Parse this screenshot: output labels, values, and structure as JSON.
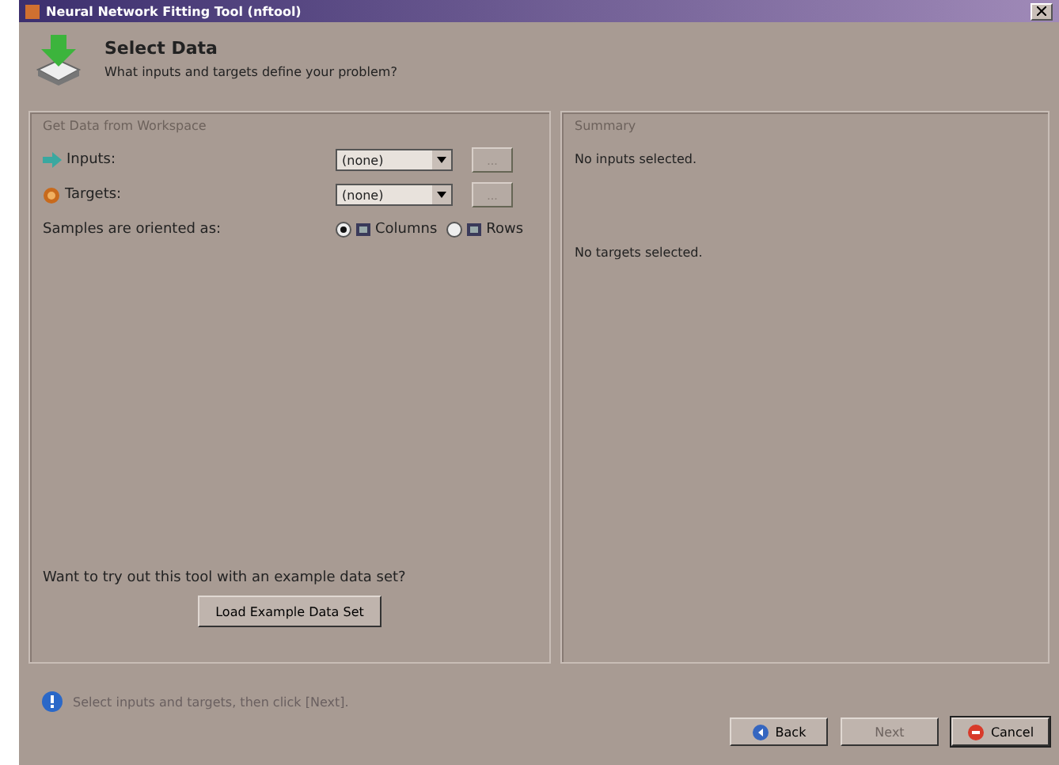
{
  "window": {
    "title": "Neural Network Fitting Tool (nftool)"
  },
  "header": {
    "title": "Select Data",
    "subtitle": "What inputs and targets define your problem?"
  },
  "workspace": {
    "title": "Get Data from Workspace",
    "rows": [
      {
        "kind": "inputs",
        "label": "Inputs:",
        "value": "(none)",
        "browse": "..."
      },
      {
        "kind": "targets",
        "label": "Targets:",
        "value": "(none)",
        "browse": "..."
      }
    ],
    "orientation": {
      "label": "Samples are oriented as:",
      "options": [
        {
          "label": "Columns",
          "selected": true
        },
        {
          "label": "Rows",
          "selected": false
        }
      ]
    },
    "example_prompt": "Want to try out this tool with an example data set?",
    "example_button": "Load Example Data Set"
  },
  "summary": {
    "title": "Summary",
    "lines": [
      "No inputs selected.",
      "No targets selected."
    ]
  },
  "status": "Select inputs and targets, then click [Next].",
  "buttons": [
    {
      "kind": "back",
      "label": "Back",
      "disabled": false
    },
    {
      "kind": "next",
      "label": "Next",
      "disabled": true
    },
    {
      "kind": "cancel",
      "label": "Cancel",
      "disabled": false
    }
  ]
}
